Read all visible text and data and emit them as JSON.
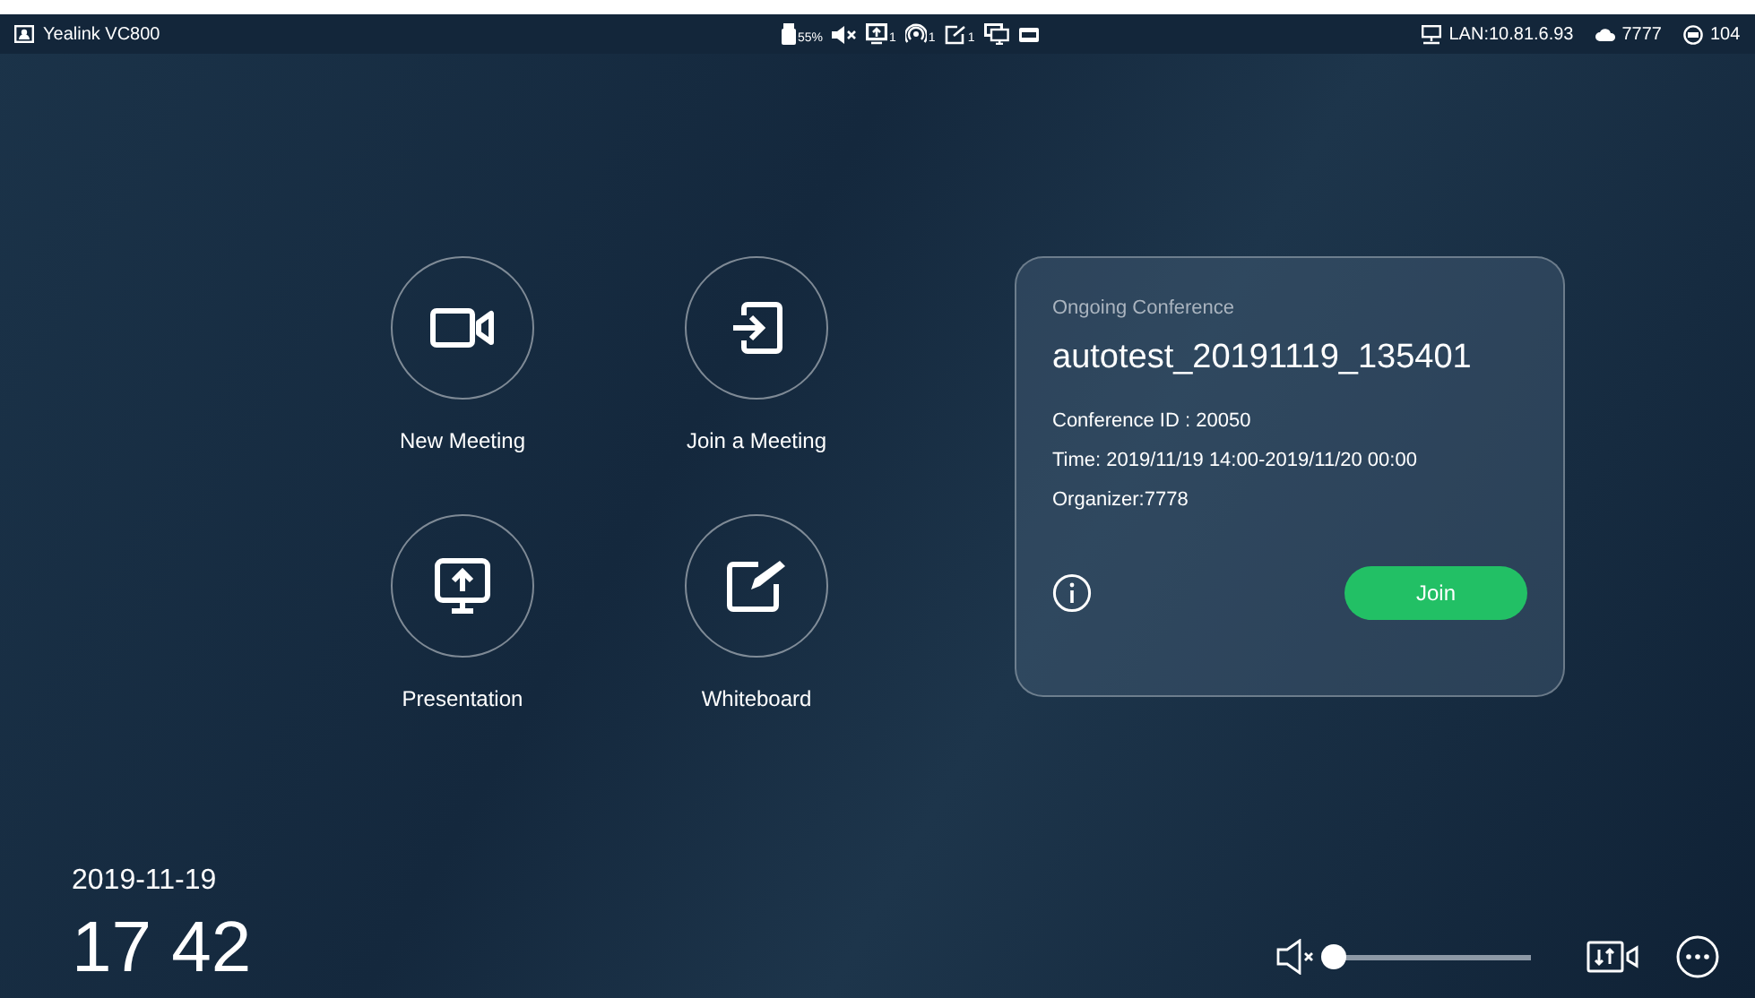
{
  "status_bar": {
    "device_name": "Yealink VC800",
    "indicators": [
      {
        "kind": "usb",
        "text": "55%"
      },
      {
        "kind": "mute"
      },
      {
        "kind": "screen",
        "text": "1"
      },
      {
        "kind": "wireless",
        "text": "1"
      },
      {
        "kind": "whiteboard",
        "text": "1"
      },
      {
        "kind": "display"
      },
      {
        "kind": "vga"
      }
    ],
    "network": "LAN:10.81.6.93",
    "cloud_account": "7777",
    "sip_account": "104"
  },
  "actions": [
    {
      "kind": "video",
      "label": "New Meeting"
    },
    {
      "kind": "join",
      "label": "Join a Meeting"
    },
    {
      "kind": "present",
      "label": "Presentation"
    },
    {
      "kind": "whiteboard",
      "label": "Whiteboard"
    }
  ],
  "conference_card": {
    "heading": "Ongoing Conference",
    "name": "autotest_20191119_135401",
    "conference_id": "Conference ID : 20050",
    "time": "Time: 2019/11/19 14:00-2019/11/20 00:00",
    "organizer": "Organizer:7778",
    "join_button": "Join"
  },
  "clock": {
    "date": "2019-11-19",
    "time": "17 42"
  },
  "volume": {
    "muted": true,
    "level": 0.02
  }
}
